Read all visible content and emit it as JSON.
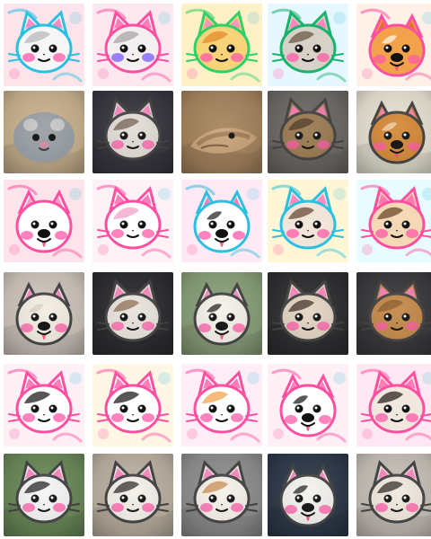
{
  "tiles": [
    {
      "kind": "drawing",
      "animal": "cat",
      "bg": "#fde3ea",
      "fur": "#f6f6f6",
      "patch": "#b8b8bc",
      "ear": "#ff7fbf",
      "cheek": "#ff5aa8",
      "outline": "#2cc0e0"
    },
    {
      "kind": "drawing",
      "animal": "cat",
      "bg": "#fde8ef",
      "fur": "#f4f0f2",
      "patch": "#a8a6a8",
      "ear": "#ff6fb3",
      "cheek": "#7a5cff",
      "outline": "#ff4fa0"
    },
    {
      "kind": "drawing",
      "animal": "cat",
      "bg": "#fff0c8",
      "fur": "#f7d37a",
      "patch": "#e38b2e",
      "ear": "#ff8fc0",
      "cheek": "#ff5aa8",
      "outline": "#2fd06a"
    },
    {
      "kind": "drawing",
      "animal": "cat",
      "bg": "#e7f7ff",
      "fur": "#d7d1c8",
      "patch": "#6b5a45",
      "ear": "#ff7fbf",
      "cheek": "#ff5aa8",
      "outline": "#19b36b"
    },
    {
      "kind": "drawing",
      "animal": "dog",
      "bg": "#fff0e8",
      "fur": "#f1a24a",
      "patch": "#fff3e6",
      "ear": "#e06a2b",
      "cheek": "#ff5aa8",
      "outline": "#ff4fa0"
    },
    {
      "kind": "photo",
      "animal": "hamster",
      "bg": "#c9b28f",
      "fur": "#9aa0a6",
      "patch": "#c8c8c8"
    },
    {
      "kind": "photo",
      "animal": "cat",
      "bg": "#3a3840",
      "fur": "#e2ddd6",
      "patch": "#6f5b4e"
    },
    {
      "kind": "photo",
      "animal": "lizard",
      "bg": "#a7855f",
      "fur": "#c9a47a",
      "patch": "#9a7450"
    },
    {
      "kind": "photo",
      "animal": "cat",
      "bg": "#6e6a66",
      "fur": "#9a7b52",
      "patch": "#4a3624"
    },
    {
      "kind": "photo",
      "animal": "dog",
      "bg": "#e7e2d3",
      "fur": "#d58a3a",
      "patch": "#f3d6b6"
    },
    {
      "kind": "drawing",
      "animal": "dog",
      "bg": "#fde3ea",
      "fur": "#ffffff",
      "patch": "#ffffff",
      "ear": "#ff8fc0",
      "cheek": "#ff5aa8",
      "outline": "#ff4fa0"
    },
    {
      "kind": "drawing",
      "animal": "cat",
      "bg": "#fff2f6",
      "fur": "#ffffff",
      "patch": "#f2a0c8",
      "ear": "#ff6fb3",
      "cheek": "#ff5aa8",
      "outline": "#ff4fa0"
    },
    {
      "kind": "drawing",
      "animal": "dog",
      "bg": "#ffe9f4",
      "fur": "#ffffff",
      "patch": "#2a2a2a",
      "ear": "#ff6fb3",
      "cheek": "#ff5aa8",
      "outline": "#2cc0e0"
    },
    {
      "kind": "drawing",
      "animal": "cat",
      "bg": "#fff6d6",
      "fur": "#f0e5d8",
      "patch": "#6a4a3a",
      "ear": "#ff7fbf",
      "cheek": "#ff5aa8",
      "outline": "#2cc0e0"
    },
    {
      "kind": "drawing",
      "animal": "cat",
      "bg": "#e8fbff",
      "fur": "#f5d8b6",
      "patch": "#6a4a2a",
      "ear": "#ff6fb3",
      "cheek": "#ff5aa8",
      "outline": "#ff4fa0"
    },
    {
      "kind": "photo",
      "animal": "dog",
      "bg": "#cfc6bd",
      "fur": "#f3ede3",
      "patch": "#d8cec2"
    },
    {
      "kind": "photo",
      "animal": "cat",
      "bg": "#2f2d31",
      "fur": "#e9e3dc",
      "patch": "#8b6a50"
    },
    {
      "kind": "photo",
      "animal": "dog",
      "bg": "#8aa07a",
      "fur": "#f5f1ea",
      "patch": "#1d1a18"
    },
    {
      "kind": "photo",
      "animal": "cat",
      "bg": "#2f3032",
      "fur": "#e3d4c2",
      "patch": "#3b2d25"
    },
    {
      "kind": "photo",
      "animal": "cat",
      "bg": "#3c3a3d",
      "fur": "#c48a4a",
      "patch": "#8a5a2a"
    },
    {
      "kind": "drawing",
      "animal": "cat",
      "bg": "#fff0f6",
      "fur": "#ffffff",
      "patch": "#1f1f1f",
      "ear": "#ff6fb3",
      "cheek": "#ff5aa8",
      "outline": "#ff4fa0"
    },
    {
      "kind": "drawing",
      "animal": "cat",
      "bg": "#fff6e6",
      "fur": "#ffffff",
      "patch": "#1f1f1f",
      "ear": "#ff6fb3",
      "cheek": "#ff5aa8",
      "outline": "#ff4fa0"
    },
    {
      "kind": "drawing",
      "animal": "cat",
      "bg": "#ffeef6",
      "fur": "#ffffff",
      "patch": "#f3a34d",
      "ear": "#ff6fb3",
      "cheek": "#ff5aa8",
      "outline": "#ff4fa0"
    },
    {
      "kind": "drawing",
      "animal": "dog",
      "bg": "#fff0f6",
      "fur": "#ffffff",
      "patch": "#222222",
      "ear": "#ff6fb3",
      "cheek": "#ff5aa8",
      "outline": "#ff4fa0"
    },
    {
      "kind": "drawing",
      "animal": "cat",
      "bg": "#ffe8f1",
      "fur": "#f0e7df",
      "patch": "#2e2422",
      "ear": "#ff6fb3",
      "cheek": "#ff5aa8",
      "outline": "#ff4fa0"
    },
    {
      "kind": "photo",
      "animal": "cat",
      "bg": "#6b8a5a",
      "fur": "#f5f5f5",
      "patch": "#1e1e1e"
    },
    {
      "kind": "photo",
      "animal": "cat",
      "bg": "#bdb2a3",
      "fur": "#f3f0ea",
      "patch": "#2a2523"
    },
    {
      "kind": "photo",
      "animal": "cat",
      "bg": "#8f8f8f",
      "fur": "#f6f1ea",
      "patch": "#c88a4b"
    },
    {
      "kind": "photo",
      "animal": "dog",
      "bg": "#2f3a4a",
      "fur": "#f4f2ee",
      "patch": "#1f1f1f"
    },
    {
      "kind": "photo",
      "animal": "cat",
      "bg": "#c7c1b8",
      "fur": "#f0e8de",
      "patch": "#2e2422"
    }
  ]
}
